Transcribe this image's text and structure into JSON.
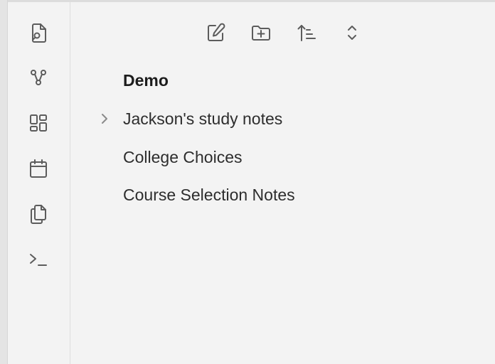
{
  "ribbon": {
    "icons": [
      {
        "name": "quick-switcher-icon"
      },
      {
        "name": "graph-view-icon"
      },
      {
        "name": "canvas-icon"
      },
      {
        "name": "daily-note-icon"
      },
      {
        "name": "templates-icon"
      },
      {
        "name": "terminal-icon"
      }
    ]
  },
  "toolbar": {
    "buttons": [
      {
        "name": "new-note-icon"
      },
      {
        "name": "new-folder-icon"
      },
      {
        "name": "sort-icon"
      },
      {
        "name": "expand-collapse-icon"
      }
    ]
  },
  "file_tree": {
    "root": {
      "label": "Demo"
    },
    "items": [
      {
        "label": "Jackson's study notes",
        "type": "folder",
        "expanded": false
      },
      {
        "label": "College Choices",
        "type": "file"
      },
      {
        "label": "Course Selection Notes",
        "type": "file"
      }
    ]
  },
  "colors": {
    "background": "#f3f3f3",
    "icon": "#5c5c5c",
    "text": "#2d2d2d"
  }
}
